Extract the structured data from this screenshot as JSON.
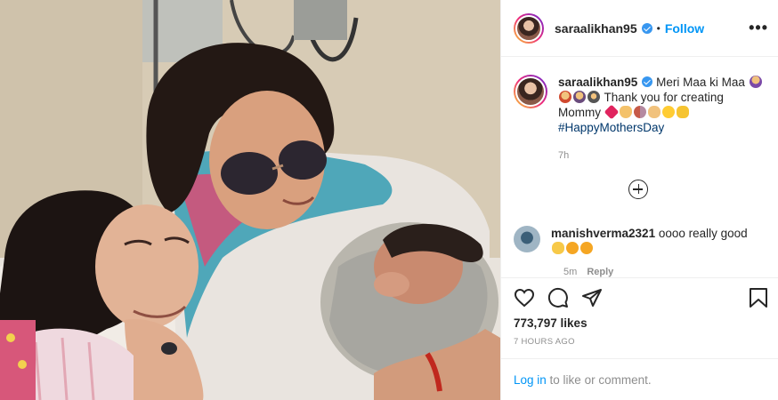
{
  "post": {
    "photo_alt": "",
    "author": {
      "username": "saraalikhan95",
      "verified": true,
      "follow_label": "Follow",
      "dot": "•",
      "more_label": "•••"
    },
    "caption": {
      "username": "saraalikhan95",
      "text_part1": "Meri Maa ki Maa",
      "text_part2": "Thank you for creating Mommy",
      "hashtag": "#HappyMothersDay",
      "time": "7h"
    },
    "comment": {
      "username": "manishverma2321",
      "text": "oooo really good",
      "time": "5m",
      "reply_label": "Reply"
    },
    "stats": {
      "likes": "773,797 likes",
      "time_ago": "7 HOURS AGO"
    },
    "login": {
      "link_label": "Log in",
      "rest": " to like or comment."
    }
  },
  "colors": {
    "accent": "#0095f6",
    "text": "#262626",
    "muted": "#8e8e8e",
    "hashtag": "#00376b",
    "verified": "#3897f0",
    "border": "#efefef"
  },
  "icons": [
    "verified-badge-icon",
    "more-options-icon",
    "load-more-comments-icon",
    "heart-icon",
    "comment-icon",
    "share-icon",
    "bookmark-icon"
  ]
}
